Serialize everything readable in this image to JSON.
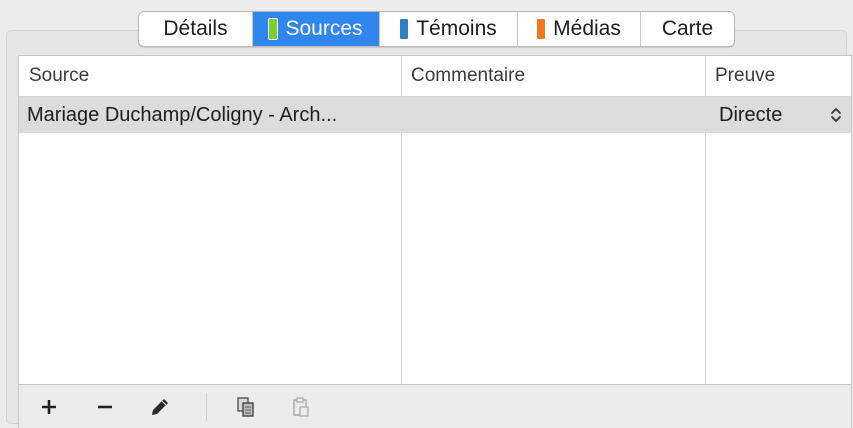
{
  "tabs": [
    {
      "label": "Détails",
      "swatch": null,
      "active": false
    },
    {
      "label": "Sources",
      "swatch": "#7ad12b",
      "active": true
    },
    {
      "label": "Témoins",
      "swatch": "#2f7fc1",
      "active": false
    },
    {
      "label": "Médias",
      "swatch": "#f07a1c",
      "active": false
    },
    {
      "label": "Carte",
      "swatch": null,
      "active": false
    }
  ],
  "table": {
    "columns": [
      "Source",
      "Commentaire",
      "Preuve"
    ],
    "rows": [
      {
        "source": "Mariage Duchamp/Coligny - Arch...",
        "commentaire": "",
        "preuve": "Directe"
      }
    ]
  },
  "toolbar": {
    "icons": [
      "add-icon",
      "remove-icon",
      "edit-pencil-icon",
      "copy-icon",
      "paste-icon"
    ]
  },
  "colors": {
    "active_tab": "#2f86ee",
    "selected_row": "#dcdcdc"
  }
}
